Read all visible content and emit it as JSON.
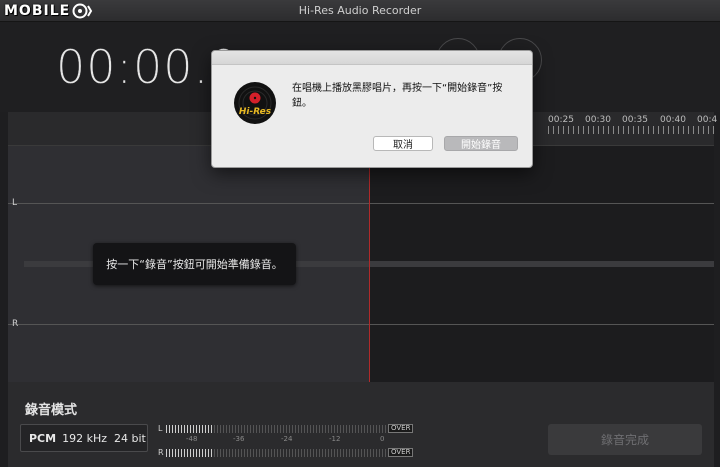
{
  "window": {
    "title": "Hi-Res Audio Recorder"
  },
  "watermark": {
    "text": "MOBILE"
  },
  "timer": {
    "display": "00:00.0"
  },
  "ruler": {
    "labels": [
      "00:25",
      "00:30",
      "00:35",
      "00:40",
      "00:4"
    ]
  },
  "waveform": {
    "left_channel": "L",
    "right_channel": "R"
  },
  "tooltip": {
    "text": "按一下“錄音”按鈕可開始準備錄音。"
  },
  "bottom": {
    "mode_title": "錄音模式",
    "format": "PCM",
    "sample_rate": "192 kHz",
    "bit_depth": "24 bit",
    "meter": {
      "left_label": "L",
      "right_label": "R",
      "over_label": "OVER",
      "scale": [
        "-48",
        "-36",
        "-24",
        "-12",
        "0"
      ]
    },
    "done_label": "錄音完成"
  },
  "dialog": {
    "message": "在唱機上播放黑膠唱片，再按一下“開始錄音”按鈕。",
    "logo_text": "Hi-Res",
    "cancel_label": "取消",
    "start_label": "開始錄音"
  },
  "colors": {
    "playhead": "#b02a2a",
    "logo_gold": "#e8b923",
    "record_red": "#d4202a"
  }
}
